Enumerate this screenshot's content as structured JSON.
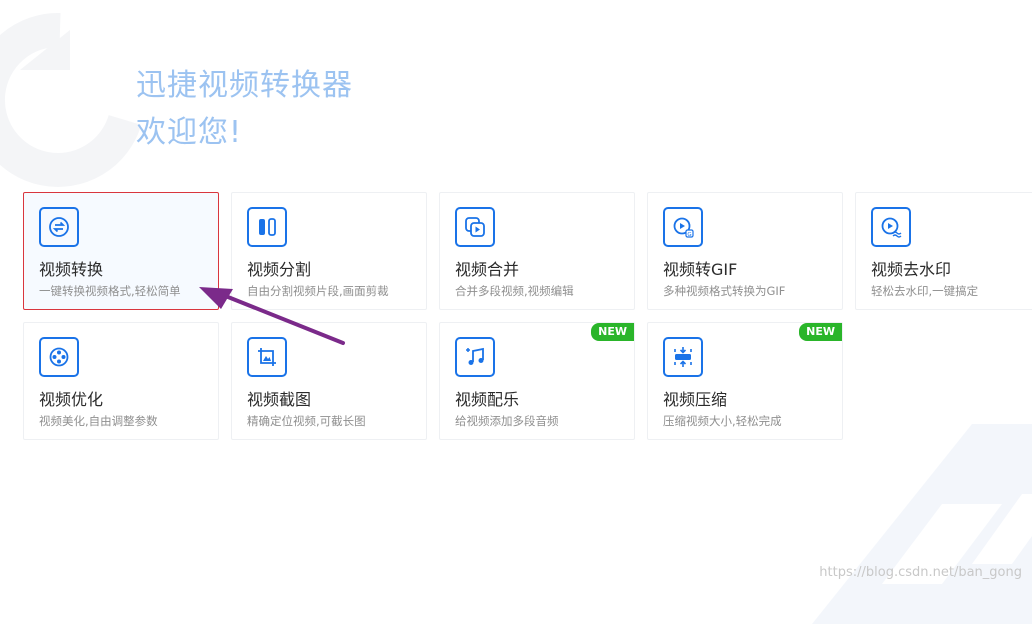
{
  "header": {
    "app_title": "迅捷视频转换器",
    "welcome": "欢迎您!"
  },
  "colors": {
    "accent": "#1a73e8",
    "title_text": "#9cc3f1",
    "badge": "#2ab52a",
    "selected_border": "#d9363e",
    "arrow": "#7b2a8a"
  },
  "tools": [
    {
      "id": "video-convert",
      "icon": "convert-icon",
      "name": "视频转换",
      "desc": "一键转换视频格式,轻松简单",
      "badge": "",
      "selected": true
    },
    {
      "id": "video-split",
      "icon": "split-icon",
      "name": "视频分割",
      "desc": "自由分割视频片段,画面剪裁",
      "badge": ""
    },
    {
      "id": "video-merge",
      "icon": "merge-icon",
      "name": "视频合并",
      "desc": "合并多段视频,视频编辑",
      "badge": ""
    },
    {
      "id": "video-to-gif",
      "icon": "gif-icon",
      "name": "视频转GIF",
      "desc": "多种视频格式转换为GIF",
      "badge": ""
    },
    {
      "id": "video-remove-watermark",
      "icon": "watermark-icon",
      "name": "视频去水印",
      "desc": "轻松去水印,一键搞定",
      "badge": ""
    },
    {
      "id": "video-optimize",
      "icon": "film-reel-icon",
      "name": "视频优化",
      "desc": "视频美化,自由调整参数",
      "badge": ""
    },
    {
      "id": "video-screenshot",
      "icon": "image-crop-icon",
      "name": "视频截图",
      "desc": "精确定位视频,可截长图",
      "badge": ""
    },
    {
      "id": "video-music",
      "icon": "music-note-icon",
      "name": "视频配乐",
      "desc": "给视频添加多段音频",
      "badge": "NEW"
    },
    {
      "id": "video-compress",
      "icon": "compress-icon",
      "name": "视频压缩",
      "desc": "压缩视频大小,轻松完成",
      "badge": "NEW"
    }
  ],
  "footer": {
    "watermark": "https://blog.csdn.net/ban_gong"
  }
}
